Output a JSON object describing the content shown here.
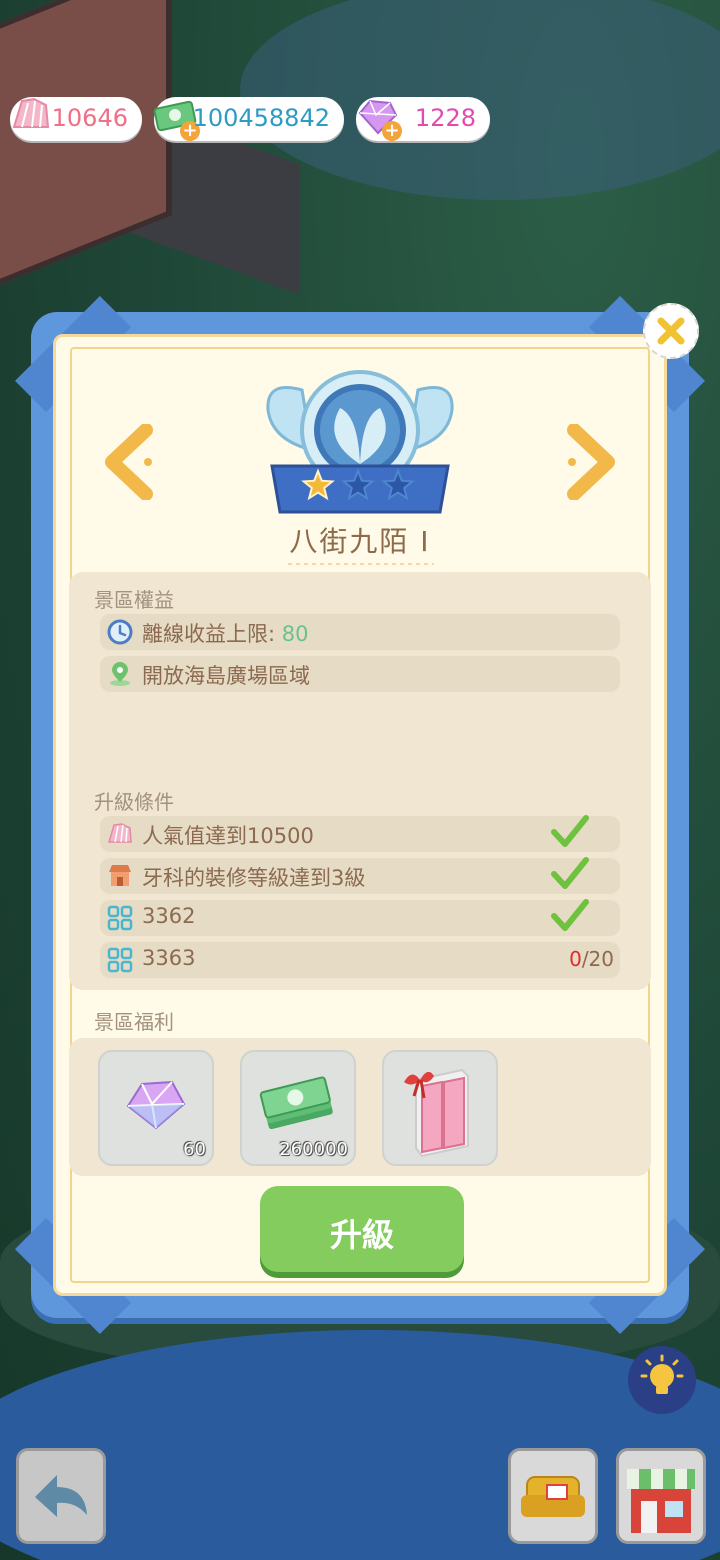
{
  "currencies": [
    {
      "id": "popularity",
      "value": "10646",
      "color": "#f06e86",
      "has_plus": false
    },
    {
      "id": "cash",
      "value": "100458842",
      "color": "#2d9bc4",
      "has_plus": true
    },
    {
      "id": "gems",
      "value": "1228",
      "color": "#e34ab1",
      "has_plus": true
    }
  ],
  "badge": {
    "stars_filled": 1,
    "stars_total": 3
  },
  "title": "八街九陌 I",
  "benefits": {
    "label": "景區權益",
    "items": [
      {
        "icon": "clock-icon",
        "text": "離線收益上限:",
        "value": "80"
      },
      {
        "icon": "location-pin-icon",
        "text": "開放海島廣場區域",
        "value": ""
      }
    ]
  },
  "conditions": {
    "label": "升級條件",
    "items": [
      {
        "icon": "shell-icon",
        "text": "人氣值達到10500",
        "done": true,
        "progress": ""
      },
      {
        "icon": "shop-icon",
        "text": "牙科的裝修等級達到3級",
        "done": true,
        "progress": ""
      },
      {
        "icon": "grid-icon",
        "text": "3362",
        "done": true,
        "progress": ""
      },
      {
        "icon": "grid-icon",
        "text": "3363",
        "done": false,
        "progress_current": "0",
        "progress_total": "/20"
      }
    ]
  },
  "rewards": {
    "label": "景區福利",
    "items": [
      {
        "icon": "gem-icon",
        "amount": "60"
      },
      {
        "icon": "cash-stack-icon",
        "amount": "260000"
      },
      {
        "icon": "wardrobe-icon",
        "amount": ""
      }
    ]
  },
  "upgrade_label": "升級"
}
